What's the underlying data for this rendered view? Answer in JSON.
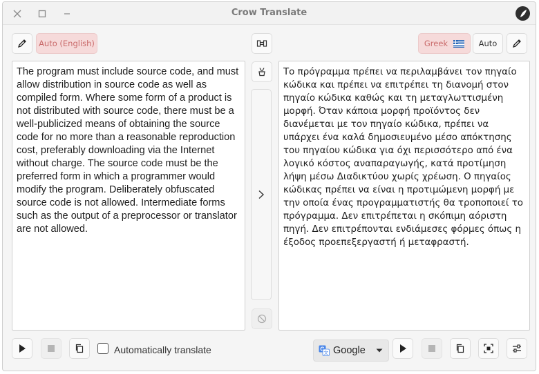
{
  "window": {
    "title": "Crow Translate"
  },
  "source": {
    "language_label": "Auto (English)",
    "text": "The program must include source code, and must allow distribution in source code as well as compiled form. Where some form of a product is not distributed with source code, there must be a well-publicized means of obtaining the source code for no more than a reasonable reproduction cost, preferably downloading via the Internet without charge. The source code must be the preferred form in which a programmer would modify the program. Deliberately obfuscated source code is not allowed. Intermediate forms such as the output of a preprocessor or translator are not allowed."
  },
  "target": {
    "language_label": "Greek",
    "auto_label": "Auto",
    "text": "Το πρόγραμμα πρέπει να περιλαμβάνει τον πηγαίο κώδικα και πρέπει να επιτρέπει τη διανομή στον πηγαίο κώδικα καθώς και τη μεταγλωττισμένη μορφή. Όταν κάποια μορφή προϊόντος δεν διανέμεται με τον πηγαίο κώδικα, πρέπει να υπάρχει ένα καλά δημοσιευμένο μέσο απόκτησης του πηγαίου κώδικα για όχι περισσότερο από ένα λογικό κόστος αναπαραγωγής, κατά προτίμηση λήψη μέσω Διαδικτύου χωρίς χρέωση. Ο πηγαίος κώδικας πρέπει να είναι η προτιμώμενη μορφή με την οποία ένας προγραμματιστής θα τροποποιεί το πρόγραμμα. Δεν επιτρέπεται η σκόπιμη αόριστη πηγή. Δεν επιτρέπονται ενδιάμεσες φόρμες όπως η έξοδος προεπεξεργαστή ή μεταφραστή."
  },
  "options": {
    "auto_translate_label": "Automatically translate",
    "auto_translate_checked": false
  },
  "engine": {
    "selected": "Google"
  },
  "colors": {
    "language_accent_bg": "#f6dada",
    "language_accent_text": "#c96a6a"
  }
}
